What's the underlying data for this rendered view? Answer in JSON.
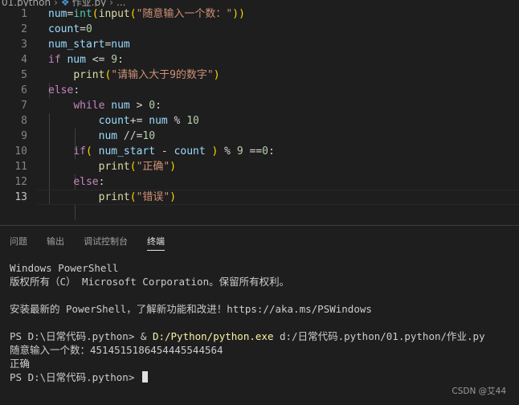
{
  "breadcrumb": {
    "folder": "01.python",
    "file": "作业.py",
    "symbol": "..."
  },
  "editor": {
    "lines": [
      {
        "n": "1",
        "tokens": [
          [
            "var",
            "num"
          ],
          [
            "op",
            "="
          ],
          [
            "bi",
            "int"
          ],
          [
            "paren",
            "("
          ],
          [
            "fn",
            "input"
          ],
          [
            "paren",
            "("
          ],
          [
            "str",
            "\"随意输入一个数：\""
          ],
          [
            "paren",
            "))"
          ]
        ]
      },
      {
        "n": "2",
        "tokens": [
          [
            "var",
            "count"
          ],
          [
            "op",
            "="
          ],
          [
            "num",
            "0"
          ]
        ]
      },
      {
        "n": "3",
        "tokens": [
          [
            "var",
            "num_start"
          ],
          [
            "op",
            "="
          ],
          [
            "var",
            "num"
          ]
        ]
      },
      {
        "n": "4",
        "tokens": [
          [
            "kw",
            "if"
          ],
          [
            "op",
            " "
          ],
          [
            "var",
            "num"
          ],
          [
            "op",
            " <= "
          ],
          [
            "num",
            "9"
          ],
          [
            "op",
            ":"
          ]
        ]
      },
      {
        "n": "5",
        "tokens": [
          [
            "op",
            "    "
          ],
          [
            "fn",
            "print"
          ],
          [
            "paren",
            "("
          ],
          [
            "str",
            "\"请输入大于9的数字\""
          ],
          [
            "paren",
            ")"
          ]
        ]
      },
      {
        "n": "6",
        "tokens": [
          [
            "kw",
            "else"
          ],
          [
            "op",
            ":"
          ]
        ]
      },
      {
        "n": "7",
        "tokens": [
          [
            "op",
            "    "
          ],
          [
            "kw",
            "while"
          ],
          [
            "op",
            " "
          ],
          [
            "var",
            "num"
          ],
          [
            "op",
            " > "
          ],
          [
            "num",
            "0"
          ],
          [
            "op",
            ":"
          ]
        ]
      },
      {
        "n": "8",
        "tokens": [
          [
            "op",
            "        "
          ],
          [
            "var",
            "count"
          ],
          [
            "op",
            "+= "
          ],
          [
            "var",
            "num"
          ],
          [
            "op",
            " % "
          ],
          [
            "num",
            "10"
          ]
        ]
      },
      {
        "n": "9",
        "tokens": [
          [
            "op",
            "        "
          ],
          [
            "var",
            "num"
          ],
          [
            "op",
            " //="
          ],
          [
            "num",
            "10"
          ]
        ]
      },
      {
        "n": "10",
        "tokens": [
          [
            "op",
            "    "
          ],
          [
            "kw",
            "if"
          ],
          [
            "paren",
            "("
          ],
          [
            "op",
            " "
          ],
          [
            "var",
            "num_start"
          ],
          [
            "op",
            " - "
          ],
          [
            "var",
            "count"
          ],
          [
            "op",
            " "
          ],
          [
            "paren",
            ")"
          ],
          [
            "op",
            " % "
          ],
          [
            "num",
            "9"
          ],
          [
            "op",
            " =="
          ],
          [
            "num",
            "0"
          ],
          [
            "op",
            ":"
          ]
        ]
      },
      {
        "n": "11",
        "tokens": [
          [
            "op",
            "        "
          ],
          [
            "fn",
            "print"
          ],
          [
            "paren",
            "("
          ],
          [
            "str",
            "\"正确\""
          ],
          [
            "paren",
            ")"
          ]
        ]
      },
      {
        "n": "12",
        "tokens": [
          [
            "op",
            "    "
          ],
          [
            "kw",
            "else"
          ],
          [
            "op",
            ":"
          ]
        ]
      },
      {
        "n": "13",
        "tokens": [
          [
            "op",
            "        "
          ],
          [
            "fn",
            "print"
          ],
          [
            "paren",
            "("
          ],
          [
            "str",
            "\"错误\""
          ],
          [
            "paren",
            ")"
          ]
        ]
      }
    ],
    "active_line": "13"
  },
  "panel": {
    "tabs": [
      {
        "label": "问题",
        "active": false
      },
      {
        "label": "输出",
        "active": false
      },
      {
        "label": "调试控制台",
        "active": false
      },
      {
        "label": "终端",
        "active": true
      }
    ]
  },
  "terminal": {
    "header1": "Windows PowerShell",
    "header2": "版权所有（C） Microsoft Corporation。保留所有权利。",
    "hint": "安装最新的 PowerShell，了解新功能和改进！https://aka.ms/PSWindows",
    "prompt1": "PS D:\\日常代码.python> ",
    "cmd_amp": "& ",
    "cmd_exe": "D:/Python/python.exe",
    "cmd_arg": " d:/日常代码.python/01.python/作业.py",
    "out1": "随意输入一个数：4514515186454445544564",
    "out2": "正确",
    "prompt2": "PS D:\\日常代码.python> "
  },
  "watermark": "CSDN @艾44"
}
